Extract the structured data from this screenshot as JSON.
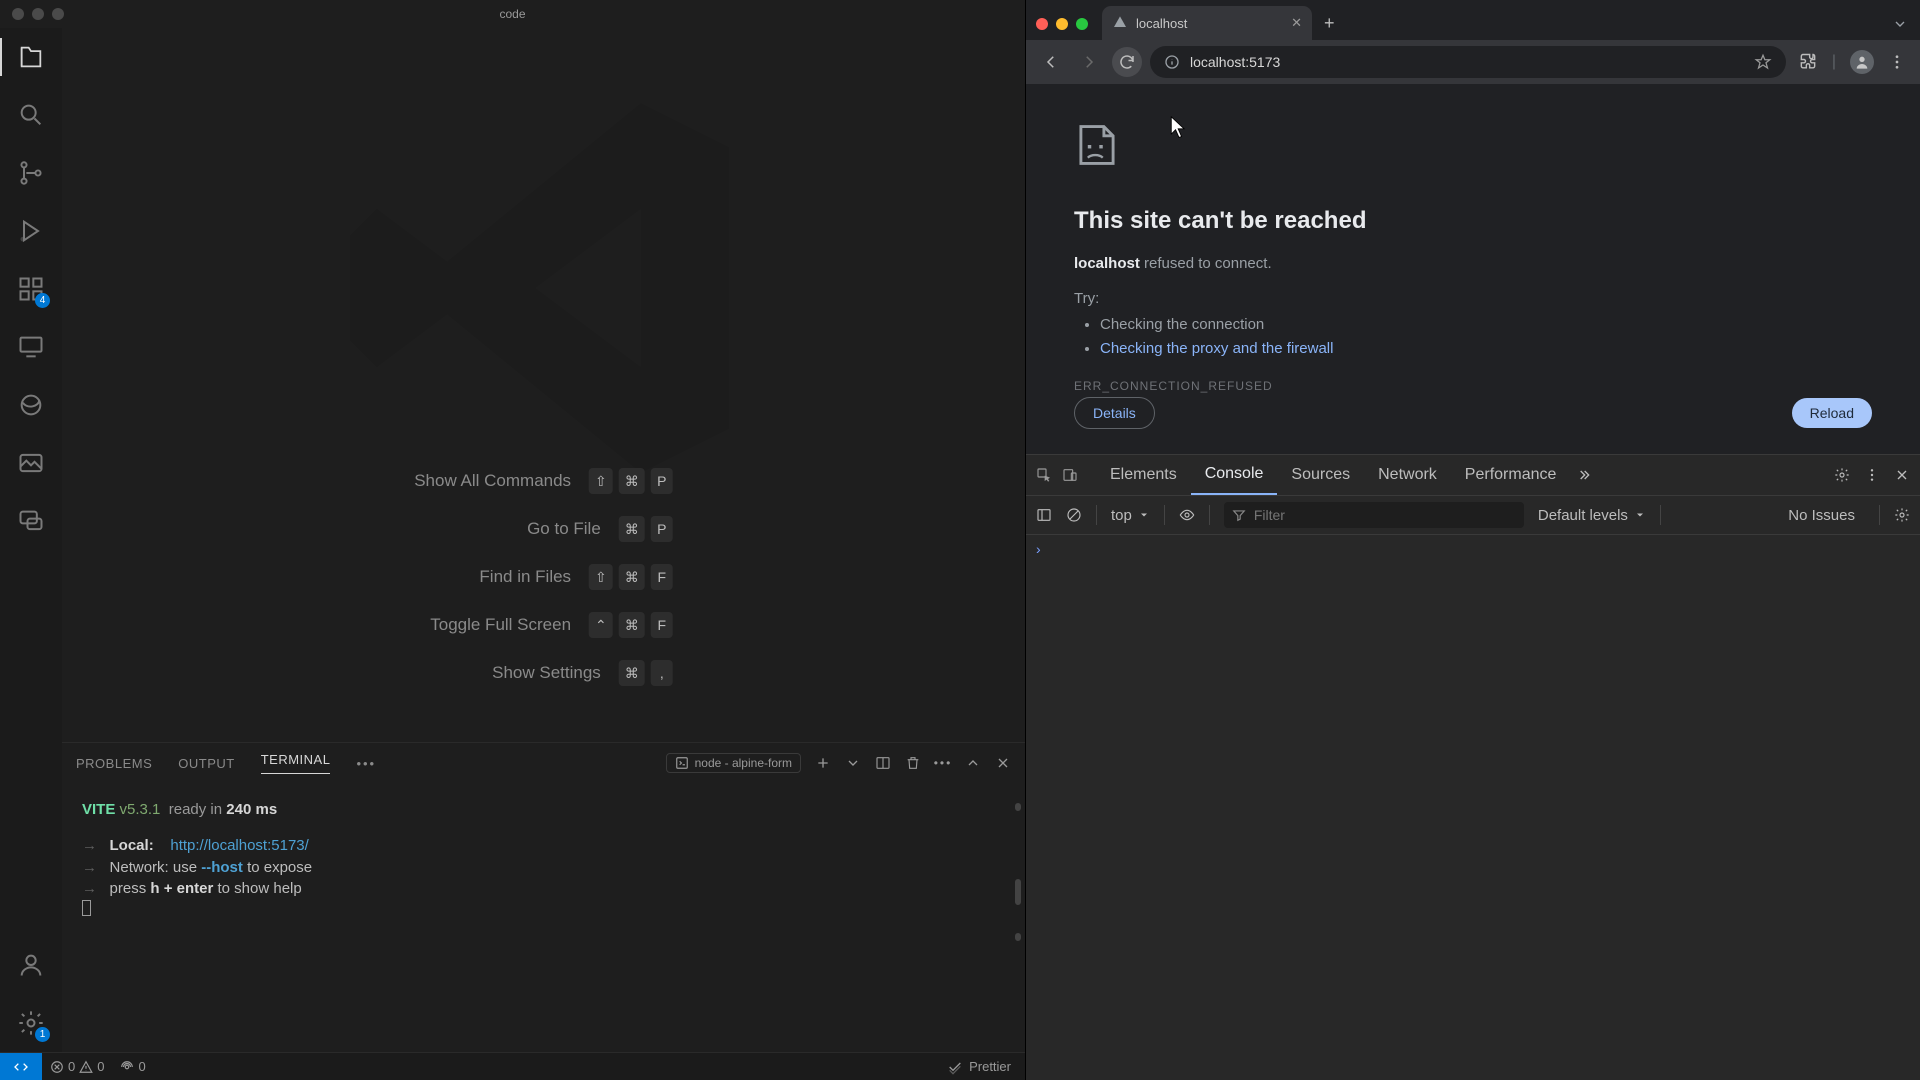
{
  "vscode": {
    "title": "code",
    "activity": {
      "extensions_badge": "4",
      "settings_badge": "1"
    },
    "shortcuts": [
      {
        "label": "Show All Commands",
        "keys": [
          "⇧",
          "⌘",
          "P"
        ]
      },
      {
        "label": "Go to File",
        "keys": [
          "⌘",
          "P"
        ]
      },
      {
        "label": "Find in Files",
        "keys": [
          "⇧",
          "⌘",
          "F"
        ]
      },
      {
        "label": "Toggle Full Screen",
        "keys": [
          "⌃",
          "⌘",
          "F"
        ]
      },
      {
        "label": "Show Settings",
        "keys": [
          "⌘",
          ","
        ]
      }
    ],
    "panel": {
      "tabs": [
        "PROBLEMS",
        "OUTPUT",
        "TERMINAL"
      ],
      "active": "TERMINAL",
      "terminal_label": "node - alpine-form"
    },
    "terminal": {
      "vite": "VITE",
      "version": "v5.3.1",
      "ready": "ready in",
      "ms": "240 ms",
      "local_label": "Local:",
      "local_url": "http://localhost:5173/",
      "network_label": "Network:",
      "network_msg_use": "use",
      "network_flag": "--host",
      "network_msg_rest": "to expose",
      "help_prefix": "press",
      "help_keys": "h + enter",
      "help_rest": "to show help"
    },
    "status": {
      "errors": "0",
      "warnings": "0",
      "ports": "0",
      "prettier": "Prettier"
    }
  },
  "chrome": {
    "tab_title": "localhost",
    "url": "localhost:5173",
    "error": {
      "title": "This site can't be reached",
      "host": "localhost",
      "refused": "refused to connect.",
      "try": "Try:",
      "item1": "Checking the connection",
      "item2": "Checking the proxy and the firewall",
      "code": "ERR_CONNECTION_REFUSED",
      "details": "Details",
      "reload": "Reload"
    },
    "devtools": {
      "tabs": [
        "Elements",
        "Console",
        "Sources",
        "Network",
        "Performance"
      ],
      "active": "Console",
      "context": "top",
      "filter_placeholder": "Filter",
      "levels": "Default levels",
      "no_issues": "No Issues"
    }
  }
}
